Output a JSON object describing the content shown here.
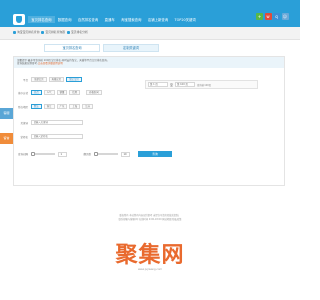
{
  "nav": {
    "items": [
      "宝贝排名查询",
      "数据查询",
      "自然排名查询",
      "直通车",
      "淘宝搜索查询",
      "店铺上新查询",
      "TOP20关键词"
    ],
    "active_index": 0,
    "icons": [
      "plus-icon",
      "weibo-icon",
      "qq-icon",
      "user-icon"
    ]
  },
  "crumbs": [
    {
      "label": "淘宝宝贝排名查询"
    },
    {
      "label": "宝贝排名查询器"
    },
    {
      "label": "宝贝排名分析"
    }
  ],
  "tabs": [
    {
      "label": "宝贝排名查询"
    },
    {
      "label": "定制关键词"
    }
  ],
  "notice": {
    "line1": "温馨提示:最多可查询前 100页宝贝排名,同时支持淘宝、天猫等平台宝贝排名查询。",
    "line2_prefix": "查询结果仅供参考,",
    "line2_link": "点击查看详细使用说明"
  },
  "form": {
    "platform_label": "平台",
    "platform_options": [
      "全部宝贝",
      "天猫宝贝",
      "淘宝宝贝"
    ],
    "platform_selected": 2,
    "sort_label": "排序方式",
    "sort_options": [
      "综合",
      "人气",
      "销量",
      "信用"
    ],
    "sort_selected": 0,
    "price_toggle_label": "价格区间",
    "range_select_1": "第 1 页",
    "range_sep": "至",
    "range_select_2": "第 100 页",
    "range_hint": "查询前100页",
    "region_label": "所在地区",
    "region_options": [
      "默认",
      "浙江",
      "广东",
      "上海",
      "江苏"
    ],
    "region_selected": 0,
    "keyword_label": "关键词",
    "keyword_placeholder": "请输入关键词",
    "nick_label": "掌柜名",
    "nick_placeholder": "请输入掌柜名",
    "interval_label": "查询间隔",
    "interval_value": "1",
    "pages_label": "翻页数",
    "pages_value": "10",
    "submit_label": "查询"
  },
  "side_tabs": [
    {
      "label": "客服",
      "color": "#5aa6d6"
    },
    {
      "label": "留言",
      "color": "#f08c3a"
    }
  ],
  "footer": {
    "line1": "版权所有 本站所有内容仅供参考 未经许可请勿转载或复制。",
    "line2": "联系邮箱与客服QQ 在线时间 9:00-18:00 网站地图 隐私政策"
  },
  "watermark": {
    "text": "聚集网",
    "sub": "www.jujiwang.com"
  },
  "colors": {
    "brand": "#2a9fd8",
    "accent": "#e96a2e"
  }
}
